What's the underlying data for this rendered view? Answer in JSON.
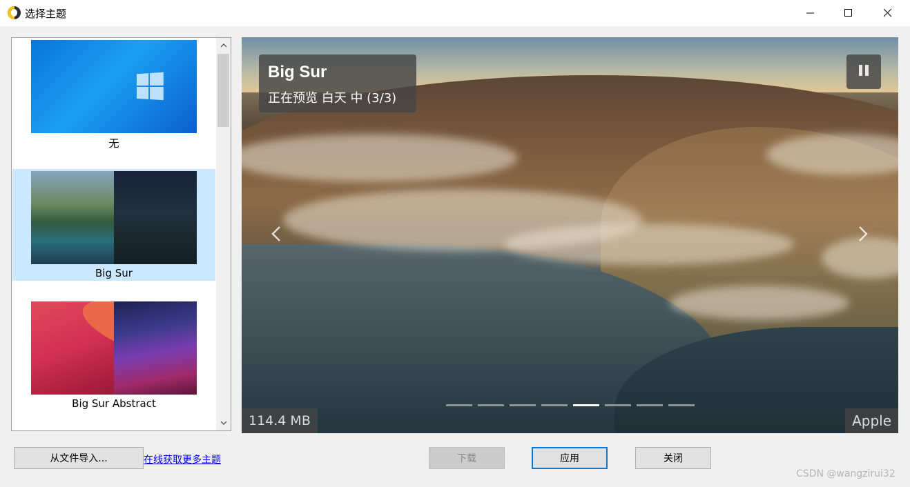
{
  "window": {
    "title": "选择主题",
    "icon": "app-icon"
  },
  "theme_list": {
    "items": [
      {
        "label": "无",
        "thumb": "windows-default-wallpaper",
        "selected": false
      },
      {
        "label": "Big Sur",
        "thumb": "big-sur-wallpaper",
        "selected": true
      },
      {
        "label": "Big Sur Abstract",
        "thumb": "big-sur-abstract-wallpaper",
        "selected": false
      }
    ]
  },
  "preview": {
    "title": "Big Sur",
    "subtitle": "正在预览 白天 中 (3/3)",
    "size": "114.4 MB",
    "author": "Apple",
    "slide_count": 8,
    "active_slide": 5
  },
  "buttons": {
    "import_label": "从文件导入...",
    "more_themes_link": "在线获取更多主题",
    "download_label": "下载",
    "apply_label": "应用",
    "close_label": "关闭"
  },
  "watermark": "CSDN @wangzirui32",
  "colors": {
    "selection": "#cce8ff",
    "accent": "#0078d7",
    "link": "#0000ee"
  }
}
